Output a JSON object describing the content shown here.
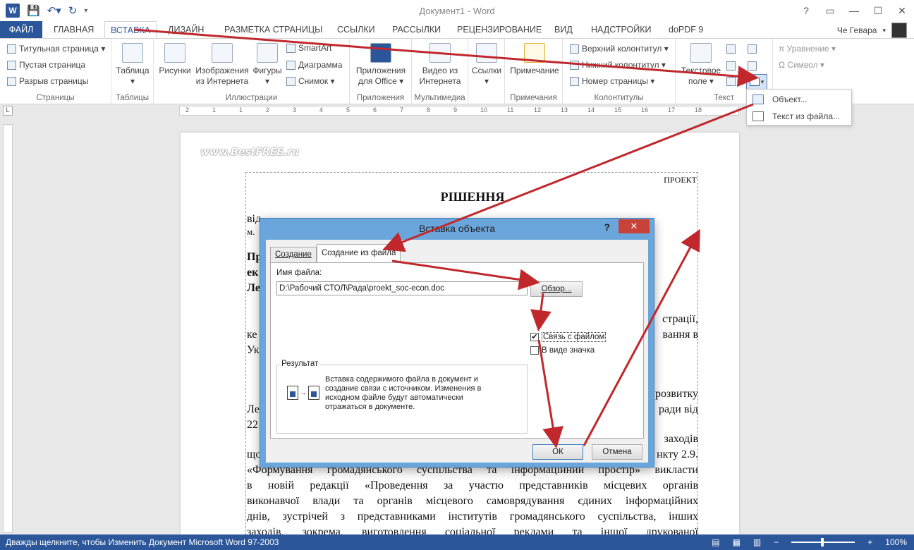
{
  "app": {
    "title": "Документ1 - Word",
    "logo": "W"
  },
  "window_controls": {
    "help": "?",
    "restore": "▭",
    "minimize": "—",
    "maximize": "☐",
    "close": "✕"
  },
  "tabs": [
    {
      "label": "ФАЙЛ"
    },
    {
      "label": "ГЛАВНАЯ"
    },
    {
      "label": "ВСТАВКА"
    },
    {
      "label": "ДИЗАЙН"
    },
    {
      "label": "РАЗМЕТКА СТРАНИЦЫ"
    },
    {
      "label": "ССЫЛКИ"
    },
    {
      "label": "РАССЫЛКИ"
    },
    {
      "label": "РЕЦЕНЗИРОВАНИЕ"
    },
    {
      "label": "ВИД"
    },
    {
      "label": "НАДСТРОЙКИ"
    },
    {
      "label": "doPDF 9"
    }
  ],
  "user": {
    "name": "Че Гевара"
  },
  "ribbon": {
    "pages": {
      "label": "Страницы",
      "items": [
        "Титульная страница ▾",
        "Пустая страница",
        "Разрыв страницы"
      ]
    },
    "tables": {
      "label": "Таблицы",
      "button": "Таблица"
    },
    "illustrations": {
      "label": "Иллюстрации",
      "pictures": "Рисунки",
      "online1": "Изображения",
      "online2": "из Интернета",
      "shapes": "Фигуры",
      "smartart": "SmartArt",
      "chart": "Диаграмма",
      "screenshot": "Снимок ▾"
    },
    "apps": {
      "label": "Приложения",
      "line1": "Приложения",
      "line2": "для Office ▾"
    },
    "media": {
      "label": "Мультимедиа",
      "line1": "Видео из",
      "line2": "Интернета"
    },
    "links": {
      "label": "",
      "button": "Ссылки"
    },
    "comments": {
      "label": "Примечания",
      "button": "Примечание"
    },
    "headers": {
      "label": "Колонтитулы",
      "items": [
        "Верхний колонтитул ▾",
        "Нижний колонтитул ▾",
        "Номер страницы ▾"
      ]
    },
    "text": {
      "label": "Текст",
      "line1": "Текстовое",
      "line2": "поле ▾"
    },
    "symbols": {
      "equation": "π  Уравнение ▾",
      "symbol": "Ω  Символ ▾"
    }
  },
  "object_menu": {
    "items": [
      "Объект...",
      "Текст из файла..."
    ]
  },
  "document": {
    "watermark": "www.BestFREE.ru",
    "proekt": "ПРОЕКТ",
    "title": "РІШЕННЯ",
    "lines": [
      "від",
      "м.",
      "Пр",
      "ек",
      "Ле",
      "страції,",
      "ке",
      "вання   в",
      "Ук",
      "розвитку",
      "Ле",
      "ради  від",
      "22",
      "заходів",
      "що",
      "нкту   2.9.",
      "«Формування громадянського суспільства та інформаційний простір» викласти",
      "в   новій   редакції   «Проведення   за   участю   представників   місцевих   органів",
      "виконавчої влади та органів місцевого самоврядування єдиних інформаційних",
      "днів, зустрічей з представниками інститутів громадянського суспільства, інших",
      "заходів,   зокрема,   виготовлення   соціальної   реклами   та   іншої   друкованої"
    ]
  },
  "dialog": {
    "title": "Вставка объекта",
    "help": "?",
    "close": "✕",
    "tabs": [
      "Создание",
      "Создание из файла"
    ],
    "filename_label": "Имя файла:",
    "filename_value": "D:\\Рабочий СТОЛ\\Рада\\proekt_soc-econ.doc",
    "browse": "Обзор...",
    "link_label": "Связь с файлом",
    "link_checked": "✔",
    "icon_label": "В виде значка",
    "result_title": "Результат",
    "result_text": "Вставка содержимого файла в документ и создание связи с источником.  Изменения в исходном файле будут автоматически отражаться в документе.",
    "ok": "ОК",
    "cancel": "Отмена"
  },
  "status": {
    "text": "Дважды щелкните, чтобы Изменить Документ Microsoft Word 97-2003",
    "zoom": "100%",
    "zoom_minus": "−",
    "zoom_plus": "+"
  },
  "ruler": {
    "corner": "L",
    "ticks": [
      "2",
      "1",
      "1",
      "2",
      "3",
      "4",
      "5",
      "6",
      "7",
      "8",
      "9",
      "10",
      "11",
      "12",
      "13",
      "14",
      "15",
      "16",
      "17",
      "18"
    ]
  },
  "colors": {
    "accent": "#2b579a",
    "arrow": "#c0282d",
    "dialog_frame": "#6aa6dc"
  }
}
